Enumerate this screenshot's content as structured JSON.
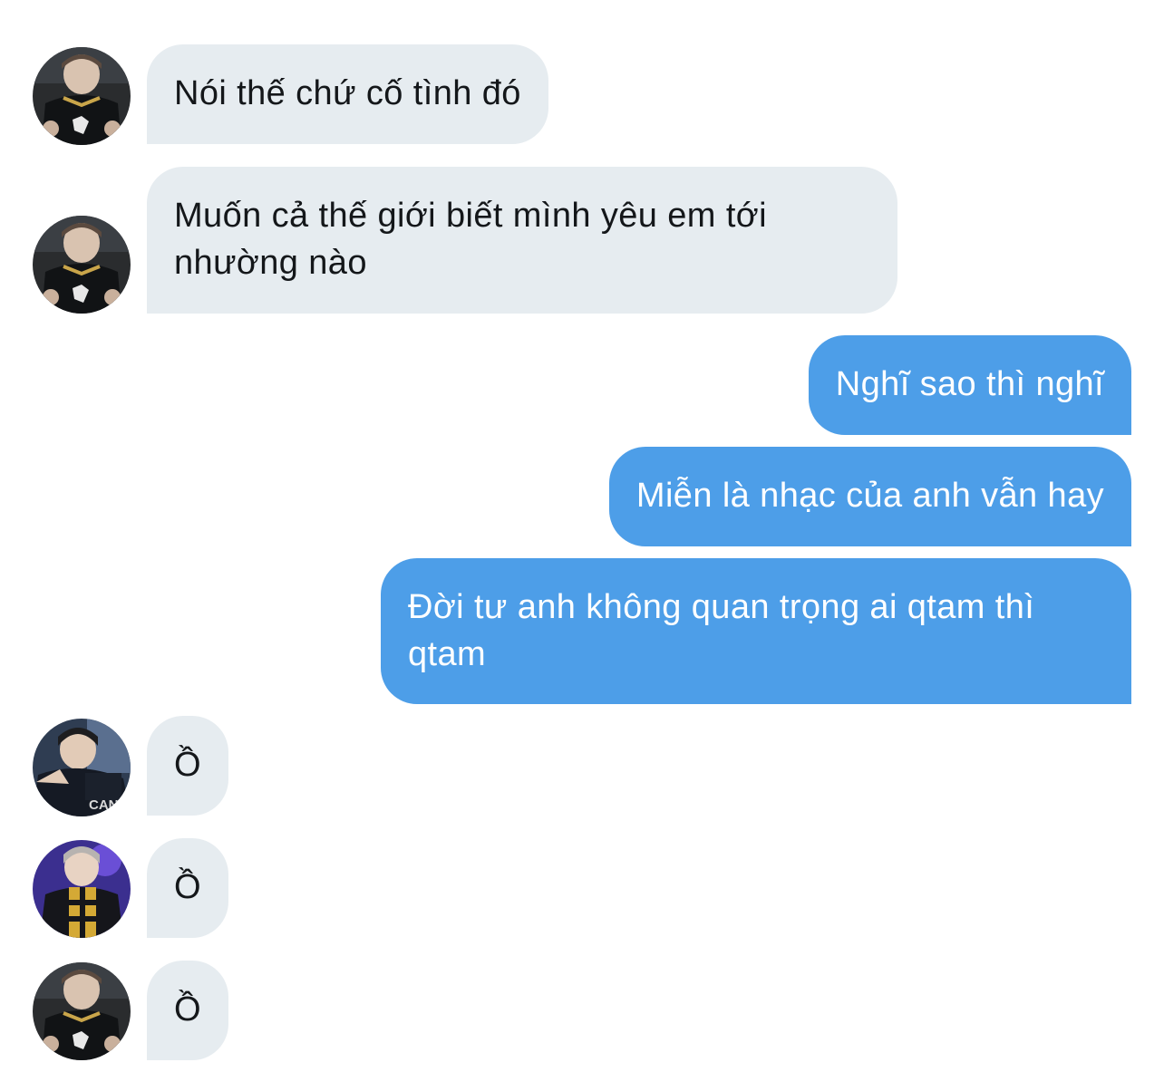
{
  "conversation": {
    "messages": [
      {
        "direction": "incoming",
        "avatar": "avatar-black-jersey",
        "text": "Nói thế chứ cố tình đó"
      },
      {
        "direction": "incoming",
        "avatar": "avatar-black-jersey",
        "text": "Muốn cả thế giới biết mình yêu em tới nhường nào"
      },
      {
        "direction": "outgoing",
        "text": "Nghĩ sao thì nghĩ"
      },
      {
        "direction": "outgoing",
        "text": "Miễn là nhạc của anh vẫn hay"
      },
      {
        "direction": "outgoing",
        "text": "Đời tư anh không quan trọng ai qtam thì qtam"
      },
      {
        "direction": "incoming",
        "avatar": "avatar-canyon-jacket",
        "text": "Ồ"
      },
      {
        "direction": "incoming",
        "avatar": "avatar-scarf-purple",
        "text": "Ồ"
      },
      {
        "direction": "incoming",
        "avatar": "avatar-black-jersey",
        "text": "Ồ"
      }
    ]
  },
  "colors": {
    "incoming_bubble": "#e6ecf0",
    "incoming_text": "#14171a",
    "outgoing_bubble": "#4d9ee8",
    "outgoing_text": "#ffffff"
  },
  "avatar_text": {
    "canyon": "CANY"
  }
}
